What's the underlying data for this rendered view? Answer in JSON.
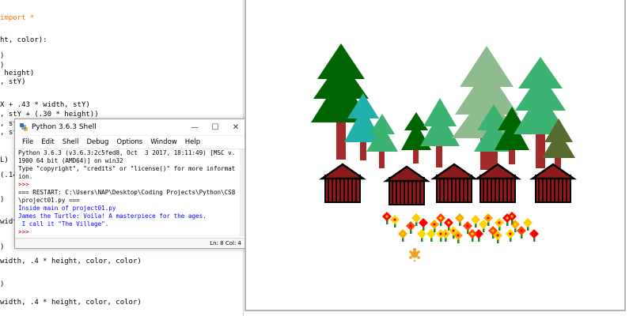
{
  "editor": {
    "lines": [
      {
        "text": "import *",
        "kw": true
      },
      {
        "text": "ht, color):"
      },
      {
        "text": ")"
      },
      {
        "text": ")"
      },
      {
        "text": " height)"
      },
      {
        "text": ", stY)"
      },
      {
        "text": "X + .43 * width, stY)"
      },
      {
        "text": ", stY + (.30 * height))"
      },
      {
        "text": ", stY + (.45 * height))"
      },
      {
        "text": ", stY"
      },
      {
        "text": "L)"
      },
      {
        "text": "(.14"
      },
      {
        "text": ")"
      },
      {
        "text": "width"
      },
      {
        "text": ")"
      },
      {
        "text": "width, .4 * height, color, color)"
      },
      {
        "text": ")"
      },
      {
        "text": "width, .4 * height, color, color)"
      }
    ]
  },
  "shell": {
    "title": "Python 3.6.3 Shell",
    "menu": [
      "File",
      "Edit",
      "Shell",
      "Debug",
      "Options",
      "Window",
      "Help"
    ],
    "lines": [
      "Python 3.6.3 (v3.6.3:2c5fed8, Oct  3 2017, 18:11:49) [MSC v.1900 64 bit (AMD64)] on win32",
      "Type \"copyright\", \"credits\" or \"license()\" for more information.",
      ">>> ",
      "=== RESTART: C:\\Users\\NAP\\Desktop\\Coding Projects\\Python\\CS8\\project01.py ===",
      "Inside main of project01.py",
      "James the Turtle: Voila! A masterpiece for the ages.",
      " I call it \"The Village\".",
      ">>> "
    ],
    "status": "Ln: 8  Col: 4"
  }
}
